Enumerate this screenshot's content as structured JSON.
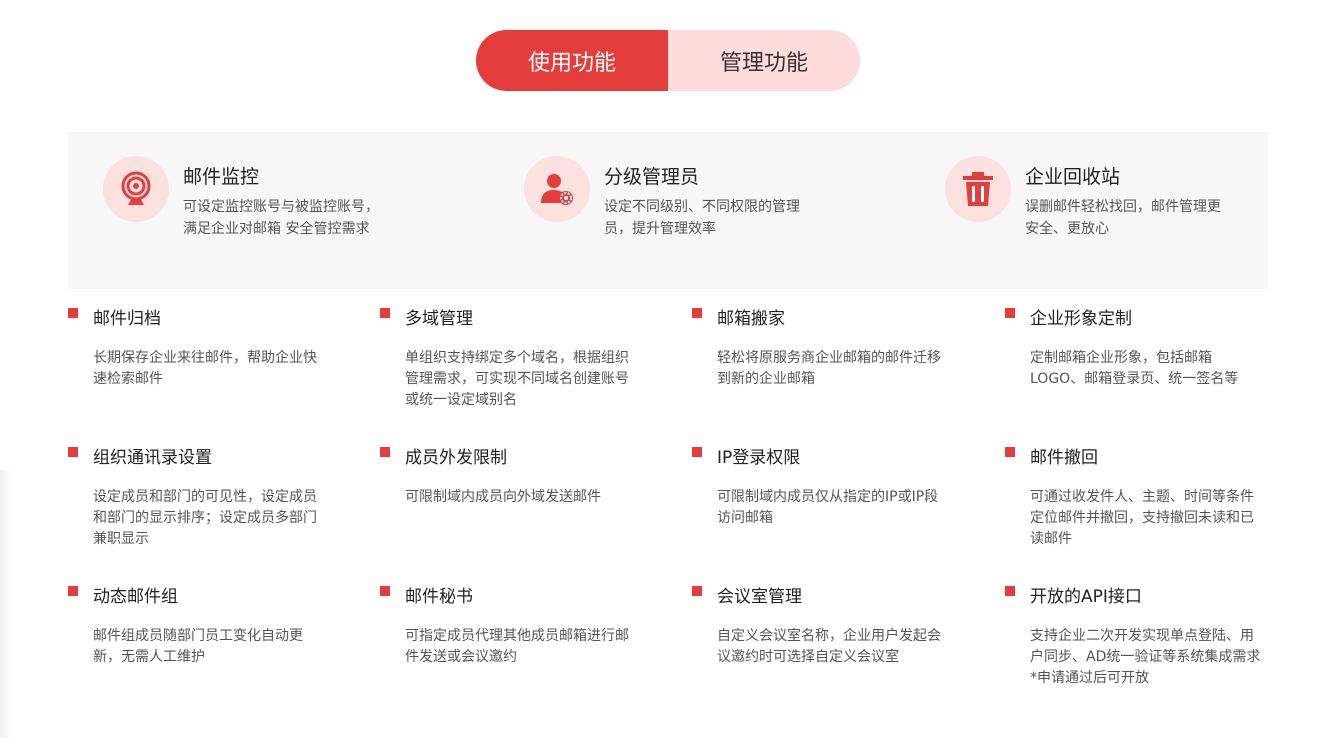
{
  "tabs": [
    {
      "label": "使用功能",
      "active": true
    },
    {
      "label": "管理功能",
      "active": false
    }
  ],
  "featured": [
    {
      "icon": "webcam-monitor-icon",
      "title": "邮件监控",
      "desc": "可设定监控账号与被监控账号，满足企业对邮箱 安全管控需求"
    },
    {
      "icon": "admin-user-gear-icon",
      "title": "分级管理员",
      "desc": "设定不同级别、不同权限的管理员，提升管理效率"
    },
    {
      "icon": "trash-bin-icon",
      "title": "企业回收站",
      "desc": "误删邮件轻松找回，邮件管理更安全、更放心"
    }
  ],
  "features": [
    {
      "title": "邮件归档",
      "desc": "长期保存企业来往邮件，帮助企业快速检索邮件"
    },
    {
      "title": "多域管理",
      "desc": "单组织支持绑定多个域名，根据组织管理需求，可实现不同域名创建账号或统一设定域别名"
    },
    {
      "title": "邮箱搬家",
      "desc": "轻松将原服务商企业邮箱的邮件迁移到新的企业邮箱"
    },
    {
      "title": "企业形象定制",
      "desc": "定制邮箱企业形象，包括邮箱LOGO、邮箱登录页、统一签名等"
    },
    {
      "title": "组织通讯录设置",
      "desc": "设定成员和部门的可见性，设定成员和部门的显示排序；设定成员多部门兼职显示"
    },
    {
      "title": "成员外发限制",
      "desc": "可限制域内成员向外域发送邮件"
    },
    {
      "title": "IP登录权限",
      "desc": "可限制域内成员仅从指定的IP或IP段访问邮箱"
    },
    {
      "title": "邮件撤回",
      "desc": "可通过收发件人、主题、时间等条件定位邮件并撤回，支持撤回未读和已读邮件"
    },
    {
      "title": "动态邮件组",
      "desc": "邮件组成员随部门员工变化自动更新，无需人工维护"
    },
    {
      "title": "邮件秘书",
      "desc": "可指定成员代理其他成员邮箱进行邮件发送或会议邀约"
    },
    {
      "title": "会议室管理",
      "desc": "自定义会议室名称，企业用户发起会议邀约时可选择自定义会议室"
    },
    {
      "title": "开放的API接口",
      "desc": "支持企业二次开发实现单点登陆、用户同步、AD统一验证等系统集成需求 *申请通过后可开放"
    }
  ],
  "colors": {
    "accent": "#e43d3b",
    "accent_light": "#fddcdb",
    "panel": "#f7f7f7"
  }
}
